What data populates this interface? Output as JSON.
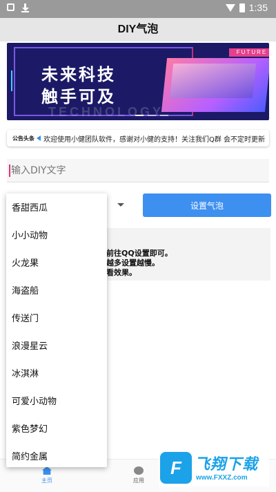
{
  "status_bar": {
    "time": "1:35"
  },
  "header": {
    "title": "DIY气泡"
  },
  "banner": {
    "slogan_line1": "未来科技",
    "slogan_line2": "触手可及",
    "tag": "FUTURE",
    "watermark_word": "TECHNOLOGY"
  },
  "notice": {
    "label": "公告头条",
    "text": "欢迎使用小健团队软件，感谢对小健的支持！关注我们Q群 会不定时更新"
  },
  "input": {
    "placeholder": "输入DIY文字"
  },
  "actions": {
    "set_bubble_label": "设置气泡"
  },
  "info": {
    "line1": "前往QQ设置即可。",
    "line2": "越多设置越慢。",
    "line3": "看效果。"
  },
  "dropdown": {
    "options": [
      "香甜西瓜",
      "小小动物",
      "火龙果",
      "海盗船",
      "传送门",
      "浪漫星云",
      "冰淇淋",
      "可爱小动物",
      "紫色梦幻",
      "简约金属"
    ]
  },
  "bottom_nav": {
    "items": [
      {
        "label": "主页",
        "icon": "home-icon",
        "active": true
      },
      {
        "label": "应用",
        "icon": "apps-icon",
        "active": false
      }
    ]
  },
  "watermark": {
    "logo": "F",
    "title": "飞翔下载",
    "url": "www.FXXZ.com"
  },
  "colors": {
    "accent": "#3d90ef",
    "banner_bg": "#1c1a66",
    "status_bar": "#9a9a9a",
    "header_bg": "#e6e6e6"
  }
}
